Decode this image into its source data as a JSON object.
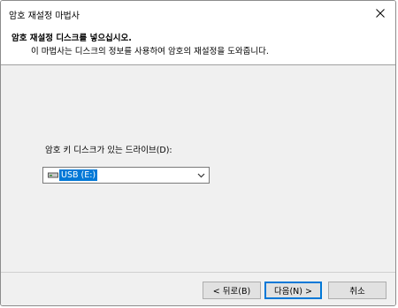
{
  "window": {
    "title": "암호 재설정 마법사",
    "close_icon": "close-icon"
  },
  "header": {
    "title": "암호 재설정 디스크를 넣으십시오.",
    "subtitle": "이 마법사는 디스크의 정보를 사용하여 암호의 재설정을 도와줍니다."
  },
  "content": {
    "drive_label": "암호 키 디스크가 있는 드라이브(D):",
    "drive_select": {
      "selected": "USB (E:)",
      "icon": "usb-drive-icon"
    }
  },
  "buttons": {
    "back": "< 뒤로(B)",
    "next": "다음(N) >",
    "cancel": "취소"
  },
  "colors": {
    "selection": "#0078d7",
    "panel": "#f0f0f0",
    "button_face": "#e1e1e1"
  }
}
